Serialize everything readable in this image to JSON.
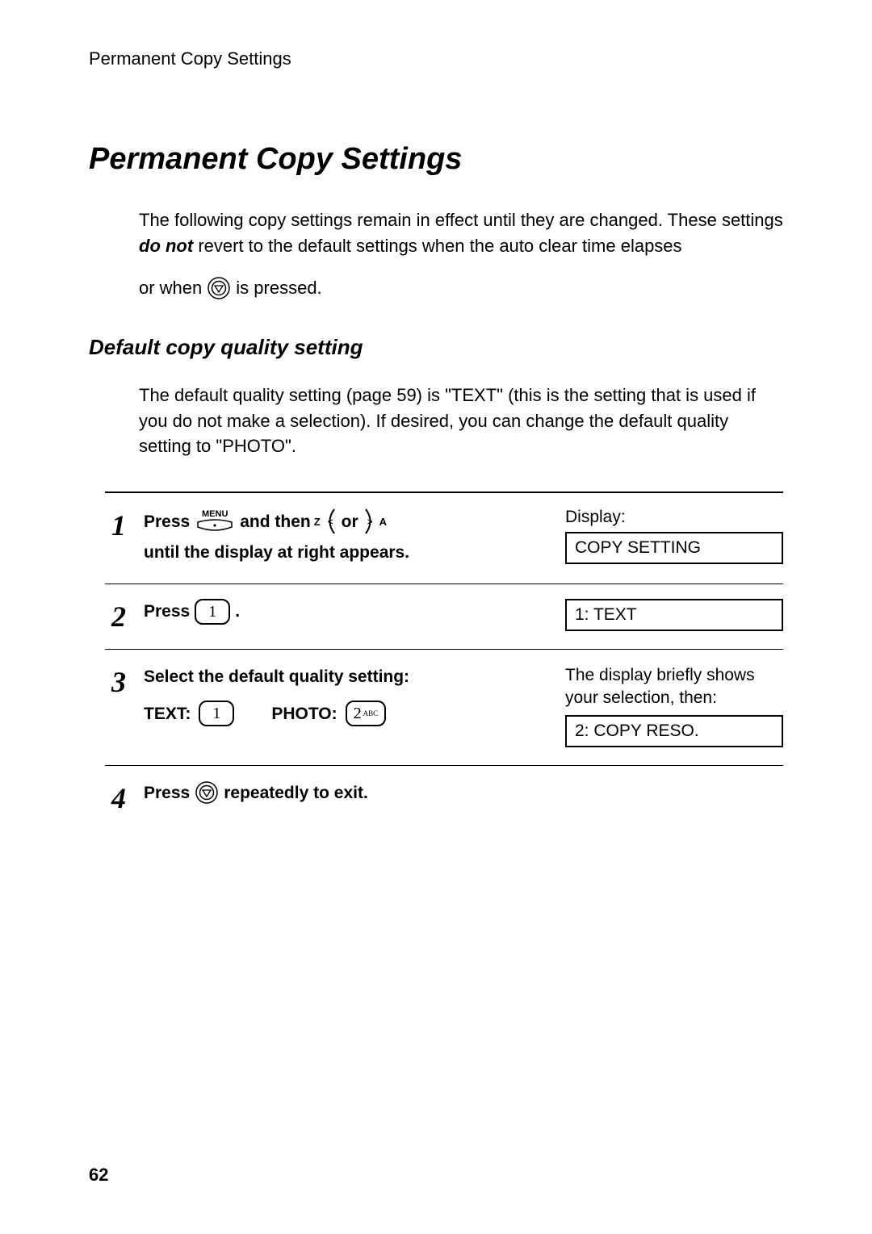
{
  "header": "Permanent Copy Settings",
  "title": "Permanent Copy Settings",
  "intro_part1": "The following copy settings remain in effect until they are changed. These settings ",
  "intro_donot": "do not",
  "intro_part2": " revert to the default settings when the auto clear time elapses",
  "intro_line2a": "or when ",
  "intro_line2b": " is pressed.",
  "subheading": "Default copy quality setting",
  "subtext": "The default quality setting (page 59) is \"TEXT\" (this is the setting that is used if you do not make a selection). If desired, you can change the default quality setting to \"PHOTO\".",
  "menu_label": "MENU",
  "steps": {
    "s1": {
      "num": "1",
      "press": "Press ",
      "and_then": " and then ",
      "or": " or ",
      "line2": "until the display at right appears.",
      "z": "Z",
      "a": "A",
      "display_label": "Display:",
      "display_box": "COPY SETTING"
    },
    "s2": {
      "num": "2",
      "press": "Press ",
      "key": "1",
      "period": ".",
      "display_box": "1: TEXT"
    },
    "s3": {
      "num": "3",
      "line1": "Select the default quality setting:",
      "text_label": "TEXT: ",
      "text_key": "1",
      "photo_label": "PHOTO: ",
      "photo_key": "2",
      "photo_sub": "ABC",
      "note": "The display briefly shows your selection, then:",
      "display_box": "2: COPY RESO."
    },
    "s4": {
      "num": "4",
      "press": "Press ",
      "rest": " repeatedly to exit."
    }
  },
  "page_number": "62"
}
